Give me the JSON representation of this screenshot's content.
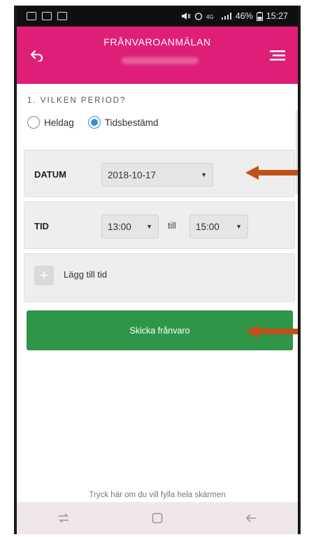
{
  "status_bar": {
    "battery": "46%",
    "time": "15:27"
  },
  "app_bar": {
    "title": "FRÅNVAROANMÄLAN",
    "back_icon": "back-arrow-icon",
    "menu_icon": "hamburger-menu-icon",
    "color": "#df1f77"
  },
  "period": {
    "heading": "1. VILKEN PERIOD?",
    "options": [
      {
        "label": "Heldag",
        "selected": false
      },
      {
        "label": "Tidsbestämd",
        "selected": true
      }
    ]
  },
  "datum": {
    "label": "DATUM",
    "value": "2018-10-17"
  },
  "tid": {
    "label": "TID",
    "from": "13:00",
    "separator": "till",
    "to": "15:00"
  },
  "add_time": {
    "label": "Lägg till tid",
    "icon": "plus-icon"
  },
  "submit": {
    "label": "Skicka frånvaro",
    "color": "#2f9647"
  },
  "annotation_arrow_color": "#c1511b",
  "fullscreen_hint": "Tryck här om du vill fylla hela skärmen",
  "nav_bar": {
    "icons": [
      "recent-apps-icon",
      "home-icon",
      "back-icon"
    ]
  }
}
